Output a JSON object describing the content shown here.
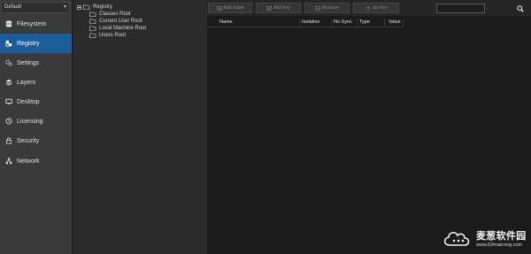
{
  "profile_selector": {
    "value": "Default"
  },
  "sidebar": {
    "items": [
      {
        "label": "Filesystem",
        "icon": "database-icon",
        "active": false
      },
      {
        "label": "Registry",
        "icon": "registry-icon",
        "active": true
      },
      {
        "label": "Settings",
        "icon": "gears-icon",
        "active": false
      },
      {
        "label": "Layers",
        "icon": "layers-icon",
        "active": false
      },
      {
        "label": "Desktop",
        "icon": "monitor-icon",
        "active": false
      },
      {
        "label": "Licensing",
        "icon": "clock-icon",
        "active": false
      },
      {
        "label": "Security",
        "icon": "lock-icon",
        "active": false
      },
      {
        "label": "Network",
        "icon": "network-icon",
        "active": false
      }
    ]
  },
  "tree": {
    "root": "Registry",
    "children": [
      "Classes Root",
      "Current User Root",
      "Local Machine Root",
      "Users Root"
    ]
  },
  "toolbar": {
    "add_value": "Add Value",
    "add_key": "Add Key",
    "remove": "Remove",
    "up_key": "Up Key"
  },
  "search": {
    "value": ""
  },
  "table": {
    "columns": [
      "Name",
      "Isolation",
      "No Sync",
      "Type",
      "Value"
    ]
  },
  "watermark": {
    "title": "麦葱软件园",
    "url": "www.52maicong.com"
  },
  "colors": {
    "active_nav": "#1c5d99",
    "sidebar_bg": "#3a3a3a",
    "content_bg": "#1b1b1b"
  }
}
